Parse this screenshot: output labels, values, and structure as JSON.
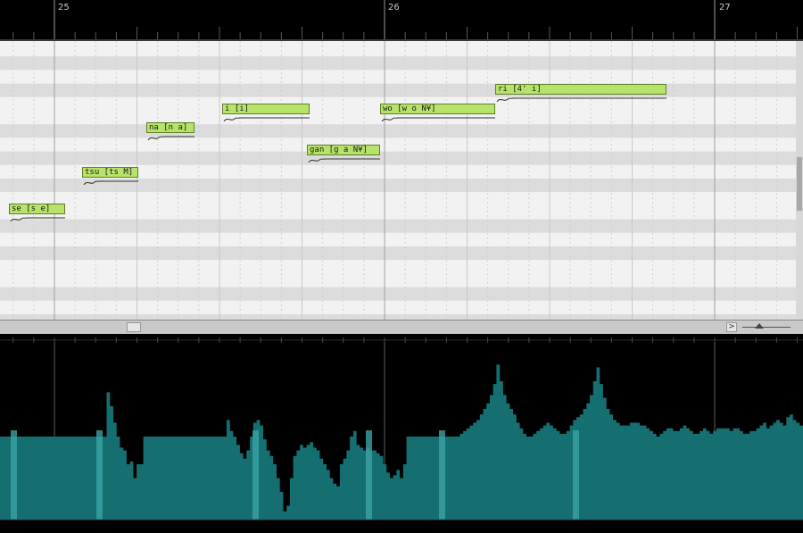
{
  "ruler": {
    "measures": [
      "25",
      "26",
      "27"
    ]
  },
  "notes": [
    {
      "lyric": "se [s e]",
      "row": 8,
      "start": 0.0,
      "end": 0.2
    },
    {
      "lyric": "tsu [ts M]",
      "row": 6,
      "start": 0.26,
      "end": 0.46
    },
    {
      "lyric": "na [n a]",
      "row": 4,
      "start": 0.49,
      "end": 0.66
    },
    {
      "lyric": "i [i]",
      "row": 3,
      "start": 0.76,
      "end": 1.07
    },
    {
      "lyric": "gan [g a N¥]",
      "row": 5,
      "start": 1.06,
      "end": 1.32
    },
    {
      "lyric": "wo [w o N¥]",
      "row": 3,
      "start": 1.32,
      "end": 1.73
    },
    {
      "lyric": "ri [4' i]",
      "row": 2,
      "start": 1.73,
      "end": 2.34
    }
  ],
  "scrollbar": {
    "right_arrow": ">"
  },
  "colors": {
    "note_fill": "#b7e36a",
    "note_border": "#5f7f28",
    "parameter_fill": "#156f71",
    "parameter_highlight": "#3aa3a5",
    "roll_background": "#f2f2f2"
  },
  "parameter_graph": {
    "description_values": [
      60,
      60,
      60,
      60,
      60,
      60,
      60,
      60,
      60,
      60,
      60,
      60,
      60,
      60,
      60,
      60,
      60,
      60,
      60,
      60,
      60,
      60,
      60,
      60,
      60,
      60,
      60,
      60,
      60,
      60,
      60,
      60,
      92,
      82,
      70,
      60,
      52,
      50,
      40,
      42,
      30,
      40,
      40,
      60,
      60,
      60,
      60,
      60,
      60,
      60,
      60,
      60,
      60,
      60,
      60,
      60,
      60,
      60,
      60,
      60,
      60,
      60,
      60,
      60,
      60,
      60,
      60,
      60,
      72,
      64,
      60,
      54,
      48,
      44,
      50,
      60,
      70,
      72,
      68,
      58,
      50,
      46,
      40,
      30,
      20,
      6,
      10,
      30,
      46,
      50,
      54,
      52,
      54,
      56,
      52,
      50,
      44,
      40,
      36,
      30,
      26,
      24,
      40,
      44,
      50,
      60,
      64,
      54,
      52,
      50,
      52,
      50,
      50,
      48,
      46,
      40,
      34,
      30,
      32,
      36,
      30,
      40,
      60,
      60,
      60,
      60,
      60,
      60,
      60,
      60,
      60,
      60,
      60,
      60,
      60,
      60,
      60,
      60,
      62,
      64,
      66,
      68,
      70,
      72,
      76,
      80,
      84,
      90,
      98,
      112,
      100,
      90,
      84,
      80,
      76,
      70,
      66,
      62,
      60,
      60,
      62,
      64,
      66,
      68,
      70,
      68,
      66,
      64,
      62,
      62,
      64,
      68,
      72,
      74,
      76,
      80,
      84,
      90,
      100,
      110,
      98,
      88,
      80,
      76,
      72,
      70,
      68,
      68,
      68,
      70,
      70,
      70,
      68,
      68,
      66,
      64,
      62,
      60,
      62,
      64,
      66,
      66,
      64,
      64,
      66,
      68,
      66,
      64,
      62,
      62,
      64,
      66,
      64,
      62,
      64,
      66,
      66,
      66,
      66,
      64,
      66,
      66,
      64,
      62,
      62,
      64,
      64,
      66,
      68,
      70,
      66,
      68,
      70,
      72,
      70,
      68,
      74,
      76,
      72,
      70,
      68
    ]
  }
}
